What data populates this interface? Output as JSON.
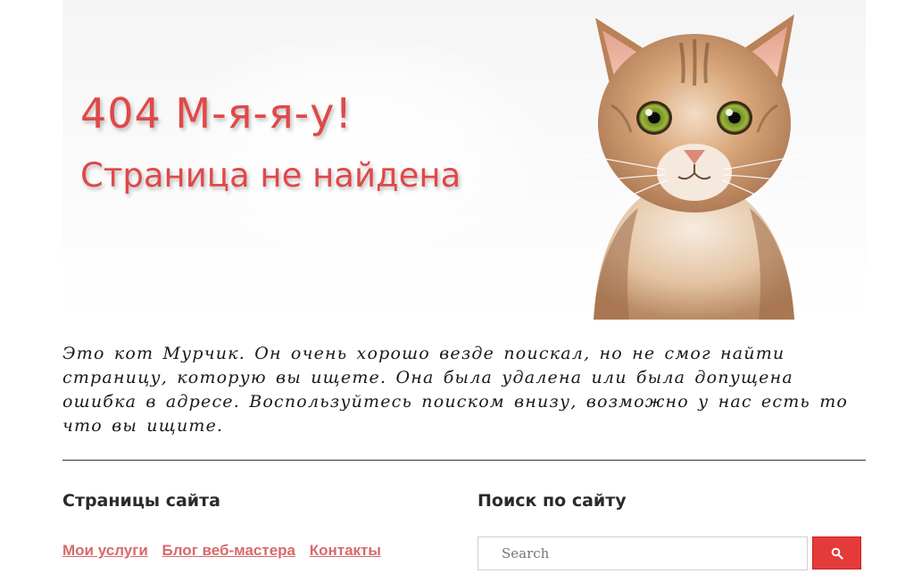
{
  "hero": {
    "title": "404 М-я-я-у!",
    "subtitle": "Страница не найдена",
    "image_icon": "cat-photo"
  },
  "description": "Это кот Мурчик. Он очень хорошо везде поискал, но не смог найти страницу, которую вы ищете. Она была удалена или была допущена ошибка в адресе. Воспользуйтесь поиском внизу, возможно у нас есть то что вы ищите.",
  "pages_section": {
    "title": "Страницы сайта",
    "links": [
      {
        "label": "Мои услуги"
      },
      {
        "label": "Блог веб-мастера"
      },
      {
        "label": "Контакты"
      }
    ]
  },
  "search_section": {
    "title": "Поиск по сайту",
    "placeholder": "Search",
    "value": "",
    "button_icon": "search-icon"
  },
  "colors": {
    "accent": "#e04848",
    "link": "#d86a6a",
    "button": "#e43a3a"
  }
}
